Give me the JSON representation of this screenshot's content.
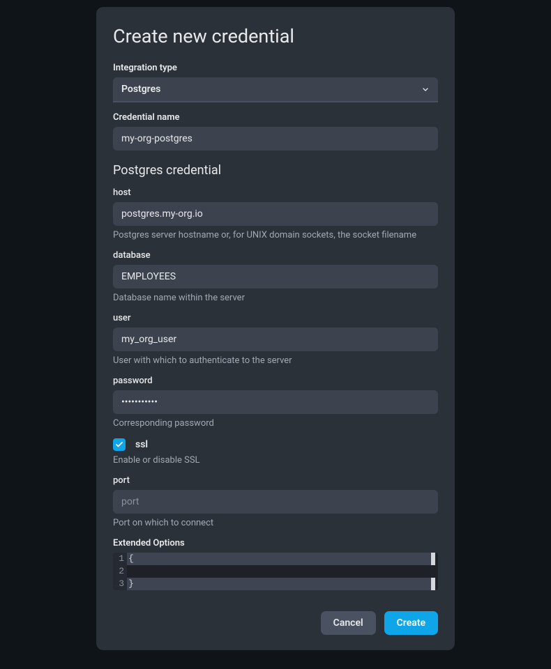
{
  "title": "Create new credential",
  "integration": {
    "label": "Integration type",
    "value": "Postgres"
  },
  "name": {
    "label": "Credential name",
    "value": "my-org-postgres"
  },
  "section_title": "Postgres credential",
  "fields": {
    "host": {
      "label": "host",
      "value": "postgres.my-org.io",
      "help": "Postgres server hostname or, for UNIX domain sockets, the socket filename"
    },
    "database": {
      "label": "database",
      "value": "EMPLOYEES",
      "help": "Database name within the server"
    },
    "user": {
      "label": "user",
      "value": "my_org_user",
      "help": "User with which to authenticate to the server"
    },
    "password": {
      "label": "password",
      "value": "•••••••••••",
      "help": "Corresponding password"
    },
    "ssl": {
      "label": "ssl",
      "checked": true,
      "help": "Enable or disable SSL"
    },
    "port": {
      "label": "port",
      "placeholder": "port",
      "value": "",
      "help": "Port on which to connect"
    },
    "extended": {
      "label": "Extended Options",
      "lines": [
        {
          "num": "1",
          "text": "{"
        },
        {
          "num": "2",
          "text": ""
        },
        {
          "num": "3",
          "text": "}"
        }
      ]
    }
  },
  "buttons": {
    "cancel": "Cancel",
    "create": "Create"
  }
}
